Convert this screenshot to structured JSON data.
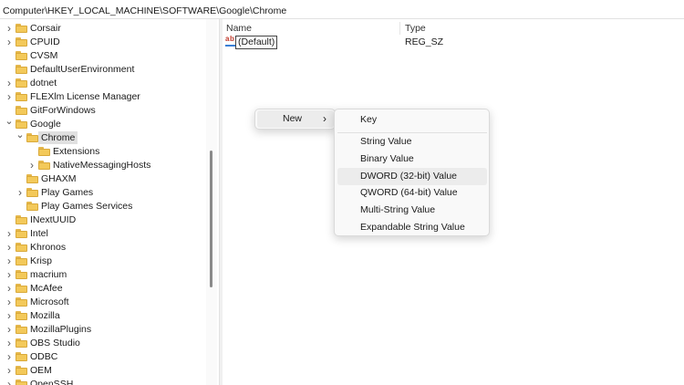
{
  "address_bar": {
    "path": "Computer\\HKEY_LOCAL_MACHINE\\SOFTWARE\\Google\\Chrome"
  },
  "tree": {
    "items": [
      {
        "label": "Corsair",
        "level": 0,
        "expander": "collapsed"
      },
      {
        "label": "CPUID",
        "level": 0,
        "expander": "collapsed"
      },
      {
        "label": "CVSM",
        "level": 0,
        "expander": "none"
      },
      {
        "label": "DefaultUserEnvironment",
        "level": 0,
        "expander": "none"
      },
      {
        "label": "dotnet",
        "level": 0,
        "expander": "collapsed"
      },
      {
        "label": "FLEXlm License Manager",
        "level": 0,
        "expander": "collapsed"
      },
      {
        "label": "GitForWindows",
        "level": 0,
        "expander": "none"
      },
      {
        "label": "Google",
        "level": 0,
        "expander": "expanded"
      },
      {
        "label": "Chrome",
        "level": 1,
        "expander": "expanded",
        "selected": true
      },
      {
        "label": "Extensions",
        "level": 2,
        "expander": "none"
      },
      {
        "label": "NativeMessagingHosts",
        "level": 2,
        "expander": "collapsed"
      },
      {
        "label": "GHAXM",
        "level": 1,
        "expander": "none"
      },
      {
        "label": "Play Games",
        "level": 1,
        "expander": "collapsed"
      },
      {
        "label": "Play Games Services",
        "level": 1,
        "expander": "none"
      },
      {
        "label": "INextUUID",
        "level": 0,
        "expander": "none"
      },
      {
        "label": "Intel",
        "level": 0,
        "expander": "collapsed"
      },
      {
        "label": "Khronos",
        "level": 0,
        "expander": "collapsed"
      },
      {
        "label": "Krisp",
        "level": 0,
        "expander": "collapsed"
      },
      {
        "label": "macrium",
        "level": 0,
        "expander": "collapsed"
      },
      {
        "label": "McAfee",
        "level": 0,
        "expander": "collapsed"
      },
      {
        "label": "Microsoft",
        "level": 0,
        "expander": "collapsed"
      },
      {
        "label": "Mozilla",
        "level": 0,
        "expander": "collapsed"
      },
      {
        "label": "MozillaPlugins",
        "level": 0,
        "expander": "collapsed"
      },
      {
        "label": "OBS Studio",
        "level": 0,
        "expander": "collapsed"
      },
      {
        "label": "ODBC",
        "level": 0,
        "expander": "collapsed"
      },
      {
        "label": "OEM",
        "level": 0,
        "expander": "collapsed"
      },
      {
        "label": "OpenSSH",
        "level": 0,
        "expander": "collapsed"
      }
    ]
  },
  "values_list": {
    "columns": {
      "name": "Name",
      "type": "Type"
    },
    "rows": [
      {
        "name": "(Default)",
        "type": "REG_SZ",
        "icon": "string-value-icon"
      }
    ]
  },
  "context_menu": {
    "new_label": "New",
    "arrow_glyph": "›"
  },
  "submenu": {
    "key": "Key",
    "items": [
      "String Value",
      "Binary Value",
      "DWORD (32-bit) Value",
      "QWORD (64-bit) Value",
      "Multi-String Value",
      "Expandable String Value"
    ],
    "highlighted": "DWORD (32-bit) Value"
  },
  "colors": {
    "folder": "#f3c95a",
    "selection": "#e0e0e0",
    "menu_bg": "#f9f9f9",
    "menu_highlight": "#ececec"
  }
}
